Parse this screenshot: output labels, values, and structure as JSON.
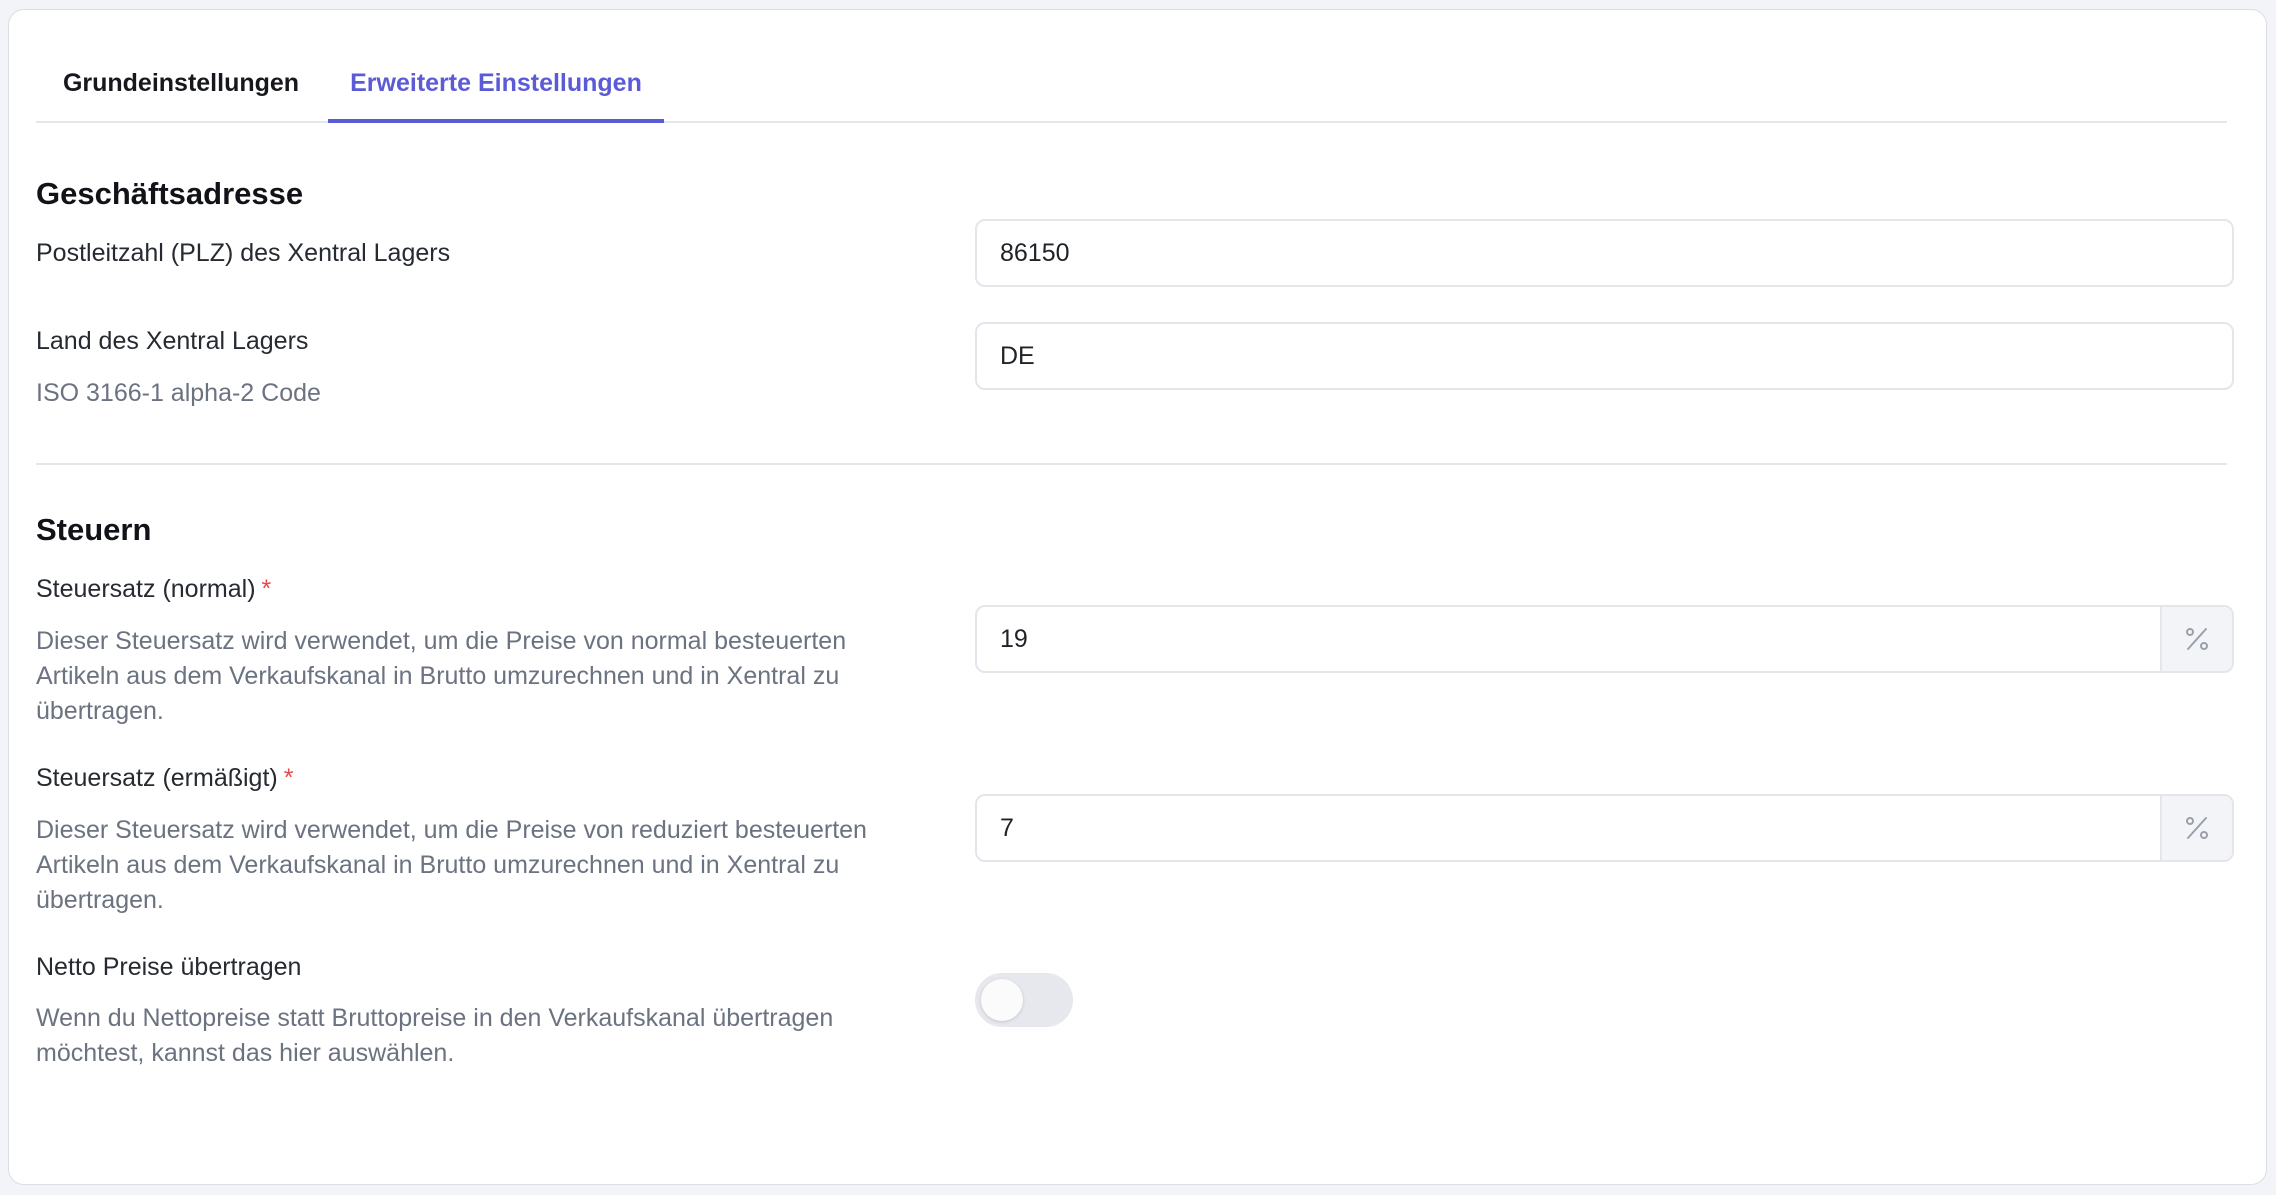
{
  "tabs": {
    "basic": "Grundeinstellungen",
    "advanced": "Erweiterte Einstellungen",
    "active": "advanced"
  },
  "business_address": {
    "title": "Geschäftsadresse",
    "zip": {
      "label": "Postleitzahl (PLZ) des Xentral Lagers",
      "value": "86150"
    },
    "country": {
      "label": "Land des Xentral Lagers",
      "help": "ISO 3166-1 alpha-2 Code",
      "value": "DE"
    }
  },
  "taxes": {
    "title": "Steuern",
    "required_marker": "*",
    "percent_icon": "percent-icon",
    "normal": {
      "label": "Steuersatz (normal)",
      "help": "Dieser Steuersatz wird verwendet, um die Preise von normal besteuerten Artikeln aus dem Verkaufskanal in Brutto umzurechnen und in Xentral zu übertragen.",
      "value": "19"
    },
    "reduced": {
      "label": "Steuersatz (ermäßigt)",
      "help": "Dieser Steuersatz wird verwendet, um die Preise von reduziert besteuerten Artikeln aus dem Verkaufskanal in Brutto umzurechnen und in Xentral zu übertragen.",
      "value": "7"
    },
    "net_prices": {
      "label": "Netto Preise übertragen",
      "help": "Wenn du Nettopreise statt Bruttopreise in den Verkaufskanal übertragen möchtest, kannst das hier auswählen.",
      "enabled": false
    }
  },
  "colors": {
    "accent": "#5b5bd6",
    "required": "#e5484d",
    "muted_text": "#6b7280",
    "border": "#e4e6eb",
    "toggle_off": "#e6e8ee"
  }
}
